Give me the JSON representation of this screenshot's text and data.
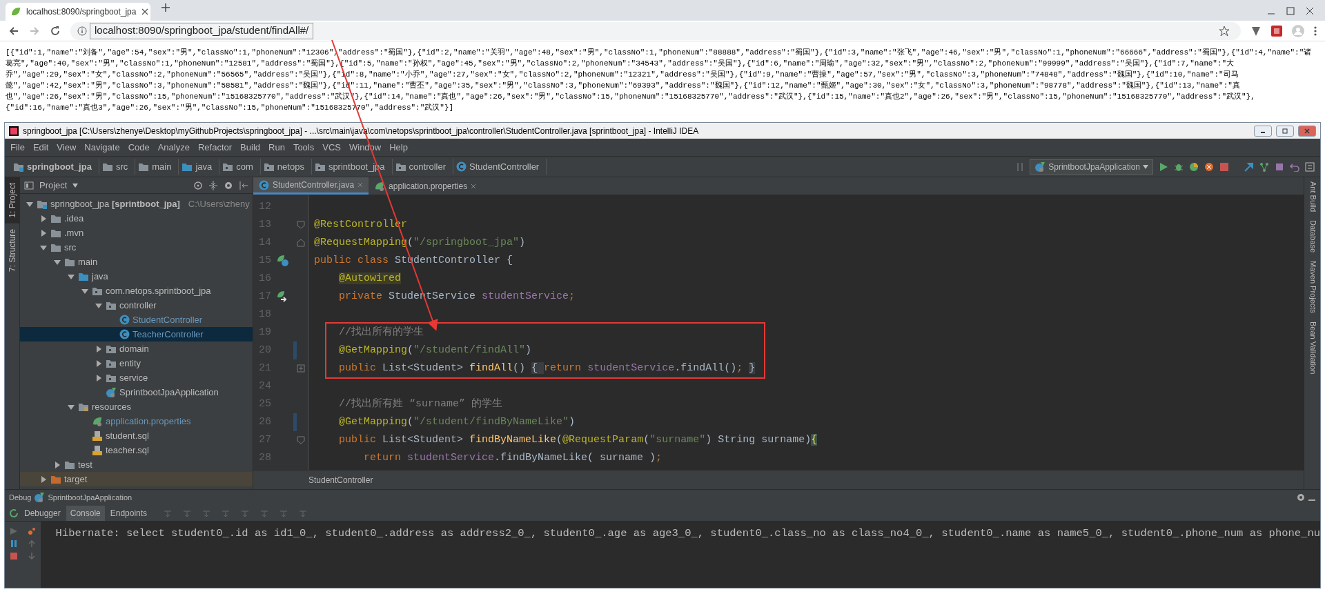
{
  "browser": {
    "tab": {
      "title": "localhost:8090/springboot_jpa"
    },
    "url": "localhost:8090/springboot_jpa/student/findAll#/",
    "body_lines": [
      "[{\"id\":1,\"name\":\"刘备\",\"age\":54,\"sex\":\"男\",\"classNo\":1,\"phoneNum\":\"12306\",\"address\":\"蜀国\"},{\"id\":2,\"name\":\"关羽\",\"age\":48,\"sex\":\"男\",\"classNo\":1,\"phoneNum\":\"88888\",\"address\":\"蜀国\"},{\"id\":3,\"name\":\"张飞\",\"age\":46,\"sex\":\"男\",\"classNo\":1,\"phoneNum\":\"66666\",\"address\":\"蜀国\"},{\"id\":4,\"name\":\"诸",
      "葛亮\",\"age\":40,\"sex\":\"男\",\"classNo\":1,\"phoneNum\":\"12581\",\"address\":\"蜀国\"},{\"id\":5,\"name\":\"孙权\",\"age\":45,\"sex\":\"男\",\"classNo\":2,\"phoneNum\":\"34543\",\"address\":\"吴国\"},{\"id\":6,\"name\":\"周瑜\",\"age\":32,\"sex\":\"男\",\"classNo\":2,\"phoneNum\":\"99999\",\"address\":\"吴国\"},{\"id\":7,\"name\":\"大",
      "乔\",\"age\":29,\"sex\":\"女\",\"classNo\":2,\"phoneNum\":\"56565\",\"address\":\"吴国\"},{\"id\":8,\"name\":\"小乔\",\"age\":27,\"sex\":\"女\",\"classNo\":2,\"phoneNum\":\"12321\",\"address\":\"吴国\"},{\"id\":9,\"name\":\"曹操\",\"age\":57,\"sex\":\"男\",\"classNo\":3,\"phoneNum\":\"74848\",\"address\":\"魏国\"},{\"id\":10,\"name\":\"司马",
      "懿\",\"age\":42,\"sex\":\"男\",\"classNo\":3,\"phoneNum\":\"58581\",\"address\":\"魏国\"},{\"id\":11,\"name\":\"曹丕\",\"age\":35,\"sex\":\"男\",\"classNo\":3,\"phoneNum\":\"69393\",\"address\":\"魏国\"},{\"id\":12,\"name\":\"甄姬\",\"age\":30,\"sex\":\"女\",\"classNo\":3,\"phoneNum\":\"98778\",\"address\":\"魏国\"},{\"id\":13,\"name\":\"真",
      "也\",\"age\":26,\"sex\":\"男\",\"classNo\":15,\"phoneNum\":\"15168325770\",\"address\":\"武汉\"},{\"id\":14,\"name\":\"真也\",\"age\":26,\"sex\":\"男\",\"classNo\":15,\"phoneNum\":\"15168325770\",\"address\":\"武汉\"},{\"id\":15,\"name\":\"真也2\",\"age\":26,\"sex\":\"男\",\"classNo\":15,\"phoneNum\":\"15168325770\",\"address\":\"武汉\"},",
      "{\"id\":16,\"name\":\"真也3\",\"age\":26,\"sex\":\"男\",\"classNo\":15,\"phoneNum\":\"15168325770\",\"address\":\"武汉\"}]"
    ]
  },
  "ide": {
    "title": "springboot_jpa [C:\\Users\\zhenye\\Desktop\\myGithubProjects\\springboot_jpa] - ...\\src\\main\\java\\com\\netops\\sprintboot_jpa\\controller\\StudentController.java [sprintboot_jpa] - IntelliJ IDEA",
    "menu": [
      "File",
      "Edit",
      "View",
      "Navigate",
      "Code",
      "Analyze",
      "Refactor",
      "Build",
      "Run",
      "Tools",
      "VCS",
      "Window",
      "Help"
    ],
    "breadcrumbs": [
      {
        "label": "springboot_jpa",
        "kind": "module"
      },
      {
        "label": "src",
        "kind": "folder"
      },
      {
        "label": "main",
        "kind": "folder"
      },
      {
        "label": "java",
        "kind": "source"
      },
      {
        "label": "com",
        "kind": "package"
      },
      {
        "label": "netops",
        "kind": "package"
      },
      {
        "label": "sprintboot_jpa",
        "kind": "package"
      },
      {
        "label": "controller",
        "kind": "package"
      },
      {
        "label": "StudentController",
        "kind": "class"
      }
    ],
    "run_config": "SprintbootJpaApplication",
    "left_tool_tabs": [
      {
        "label": "1: Project",
        "selected": true
      },
      {
        "label": "7: Structure",
        "selected": false
      }
    ],
    "right_tool_tabs": [
      "Ant Build",
      "Database",
      "Maven Projects",
      "Bean Validation"
    ],
    "project": {
      "title": "Project",
      "tree": [
        {
          "label": "springboot_jpa **[sprintboot_jpa]**",
          "hint": "C:\\Users\\zheny",
          "kind": "module",
          "expanded": true,
          "selected": false,
          "modified": false,
          "children": [
            {
              "label": ".idea",
              "kind": "folder",
              "expanded": false,
              "selected": false,
              "modified": false
            },
            {
              "label": ".mvn",
              "kind": "folder",
              "expanded": false,
              "selected": false,
              "modified": false
            },
            {
              "label": "src",
              "kind": "folder",
              "expanded": true,
              "selected": false,
              "modified": false,
              "children": [
                {
                  "label": "main",
                  "kind": "folder",
                  "expanded": true,
                  "selected": false,
                  "modified": false,
                  "children": [
                    {
                      "label": "java",
                      "kind": "source",
                      "expanded": true,
                      "selected": false,
                      "modified": false,
                      "children": [
                        {
                          "label": "com.netops.sprintboot_jpa",
                          "kind": "package",
                          "expanded": true,
                          "selected": false,
                          "modified": false,
                          "children": [
                            {
                              "label": "controller",
                              "kind": "package",
                              "expanded": true,
                              "selected": false,
                              "modified": false,
                              "children": [
                                {
                                  "label": "StudentController",
                                  "kind": "class",
                                  "selected": false,
                                  "modified": true
                                },
                                {
                                  "label": "TeacherController",
                                  "kind": "class",
                                  "selected": true,
                                  "modified": true
                                }
                              ]
                            },
                            {
                              "label": "domain",
                              "kind": "package",
                              "expanded": false,
                              "selected": false,
                              "modified": false
                            },
                            {
                              "label": "entity",
                              "kind": "package",
                              "expanded": false,
                              "selected": false,
                              "modified": false
                            },
                            {
                              "label": "service",
                              "kind": "package",
                              "expanded": false,
                              "selected": false,
                              "modified": false
                            },
                            {
                              "label": "SprintbootJpaApplication",
                              "kind": "app",
                              "selected": false,
                              "modified": false
                            }
                          ]
                        }
                      ]
                    },
                    {
                      "label": "resources",
                      "kind": "resources",
                      "expanded": true,
                      "selected": false,
                      "modified": false,
                      "children": [
                        {
                          "label": "application.properties",
                          "kind": "properties",
                          "selected": false,
                          "modified": true
                        },
                        {
                          "label": "student.sql",
                          "kind": "sql",
                          "selected": false,
                          "modified": false
                        },
                        {
                          "label": "teacher.sql",
                          "kind": "sql",
                          "selected": false,
                          "modified": false
                        }
                      ]
                    }
                  ]
                },
                {
                  "label": "test",
                  "kind": "folder",
                  "expanded": false,
                  "selected": false,
                  "modified": false
                }
              ]
            },
            {
              "label": "target",
              "kind": "excluded",
              "expanded": false,
              "selected": false,
              "modified": false
            }
          ]
        }
      ]
    },
    "editor": {
      "tabs": [
        {
          "label": "StudentController.java",
          "kind": "class",
          "selected": true
        },
        {
          "label": "application.properties",
          "kind": "properties",
          "selected": false
        }
      ],
      "lines": [
        {
          "number": "12",
          "kind": "plain",
          "changed": false,
          "highlighted": false
        },
        {
          "number": "13",
          "kind": "fold-open",
          "changed": false,
          "highlighted": false,
          "tokens": [
            {
              "text": "@RestController",
              "kind": "ann"
            }
          ]
        },
        {
          "number": "14",
          "kind": "fold-close",
          "changed": false,
          "highlighted": false,
          "tokens": [
            {
              "text": "@RequestMapping",
              "kind": "ann"
            },
            {
              "text": "(",
              "kind": "plain"
            },
            {
              "text": "\"/springboot_jpa\"",
              "kind": "str"
            },
            {
              "text": ")",
              "kind": "plain"
            }
          ]
        },
        {
          "number": "15",
          "kind": "bean",
          "changed": false,
          "highlighted": false,
          "tokens": [
            {
              "text": "public class ",
              "kind": "kw"
            },
            {
              "text": "StudentController {",
              "kind": "plain"
            }
          ]
        },
        {
          "number": "16",
          "kind": "plain",
          "changed": false,
          "highlighted": false,
          "tokens": [
            {
              "text": "@Autowired",
              "kind": "ann-mark"
            }
          ]
        },
        {
          "number": "17",
          "kind": "inject",
          "changed": false,
          "highlighted": false,
          "tokens": [
            {
              "text": "    private ",
              "kind": "kw"
            },
            {
              "text": "StudentService ",
              "kind": "plain"
            },
            {
              "text": "studentService",
              "kind": "fld"
            },
            {
              "text": ";",
              "kind": "kw"
            }
          ]
        },
        {
          "number": "18",
          "kind": "plain",
          "changed": false,
          "highlighted": false
        },
        {
          "number": "19",
          "kind": "plain",
          "changed": false,
          "highlighted": true,
          "tokens": [
            {
              "text": "    //找出所有的学生",
              "kind": "cmt"
            }
          ]
        },
        {
          "number": "20",
          "kind": "plain",
          "changed": true,
          "highlighted": true,
          "tokens": [
            {
              "text": "    @GetMapping",
              "kind": "ann"
            },
            {
              "text": "(",
              "kind": "plain"
            },
            {
              "text": "\"/student/findAll\"",
              "kind": "str"
            },
            {
              "text": ")",
              "kind": "plain"
            }
          ]
        },
        {
          "number": "21",
          "kind": "fold-collapsed",
          "changed": false,
          "highlighted": true,
          "tokens": [
            {
              "text": "    public ",
              "kind": "kw"
            },
            {
              "text": "List<Student> ",
              "kind": "plain"
            },
            {
              "text": "findAll",
              "kind": "mth"
            },
            {
              "text": "() ",
              "kind": "plain"
            },
            {
              "text": "{ ",
              "kind": "folded"
            },
            {
              "text": "return ",
              "kind": "kw"
            },
            {
              "text": "studentService",
              "kind": "fld"
            },
            {
              "text": ".findAll()",
              "kind": "plain"
            },
            {
              "text": "; ",
              "kind": "kw"
            },
            {
              "text": "}",
              "kind": "folded"
            }
          ]
        },
        {
          "number": "24",
          "kind": "plain",
          "changed": false,
          "highlighted": false
        },
        {
          "number": "25",
          "kind": "plain",
          "changed": false,
          "highlighted": false,
          "tokens": [
            {
              "text": "    //找出所有姓 “surname” 的学生",
              "kind": "cmt"
            }
          ]
        },
        {
          "number": "26",
          "kind": "plain",
          "changed": true,
          "highlighted": false,
          "tokens": [
            {
              "text": "    @GetMapping",
              "kind": "ann"
            },
            {
              "text": "(",
              "kind": "plain"
            },
            {
              "text": "\"/student/findByNameLike\"",
              "kind": "str"
            },
            {
              "text": ")",
              "kind": "plain"
            }
          ]
        },
        {
          "number": "27",
          "kind": "fold-open",
          "changed": false,
          "highlighted": false,
          "tokens": [
            {
              "text": "    public ",
              "kind": "kw"
            },
            {
              "text": "List<Student> ",
              "kind": "plain"
            },
            {
              "text": "findByNameLike",
              "kind": "mth"
            },
            {
              "text": "(",
              "kind": "plain"
            },
            {
              "text": "@RequestParam",
              "kind": "ann"
            },
            {
              "text": "(",
              "kind": "plain"
            },
            {
              "text": "\"surname\"",
              "kind": "str"
            },
            {
              "text": ") String surname)",
              "kind": "plain"
            },
            {
              "text": "{",
              "kind": "brace"
            }
          ]
        },
        {
          "number": "28",
          "kind": "plain",
          "changed": false,
          "highlighted": false,
          "tokens": [
            {
              "text": "        return ",
              "kind": "kw"
            },
            {
              "text": "studentService",
              "kind": "fld"
            },
            {
              "text": ".findByNameLike( surname )",
              "kind": "plain"
            },
            {
              "text": ";",
              "kind": "kw"
            }
          ]
        }
      ],
      "breadcrumb": "StudentController"
    },
    "debug": {
      "title": "Debug",
      "config": "SprintbootJpaApplication",
      "tabs": [
        {
          "label": "Debugger",
          "selected": false
        },
        {
          "label": "Console",
          "selected": true
        },
        {
          "label": "Endpoints",
          "selected": false
        }
      ],
      "console_lines": [
        "Hibernate: select student0_.id as id1_0_, student0_.address as address2_0_, student0_.age as age3_0_, student0_.class_no as class_no4_0_, student0_.name as name5_0_, student0_.phone_num as phone_nu"
      ]
    }
  }
}
